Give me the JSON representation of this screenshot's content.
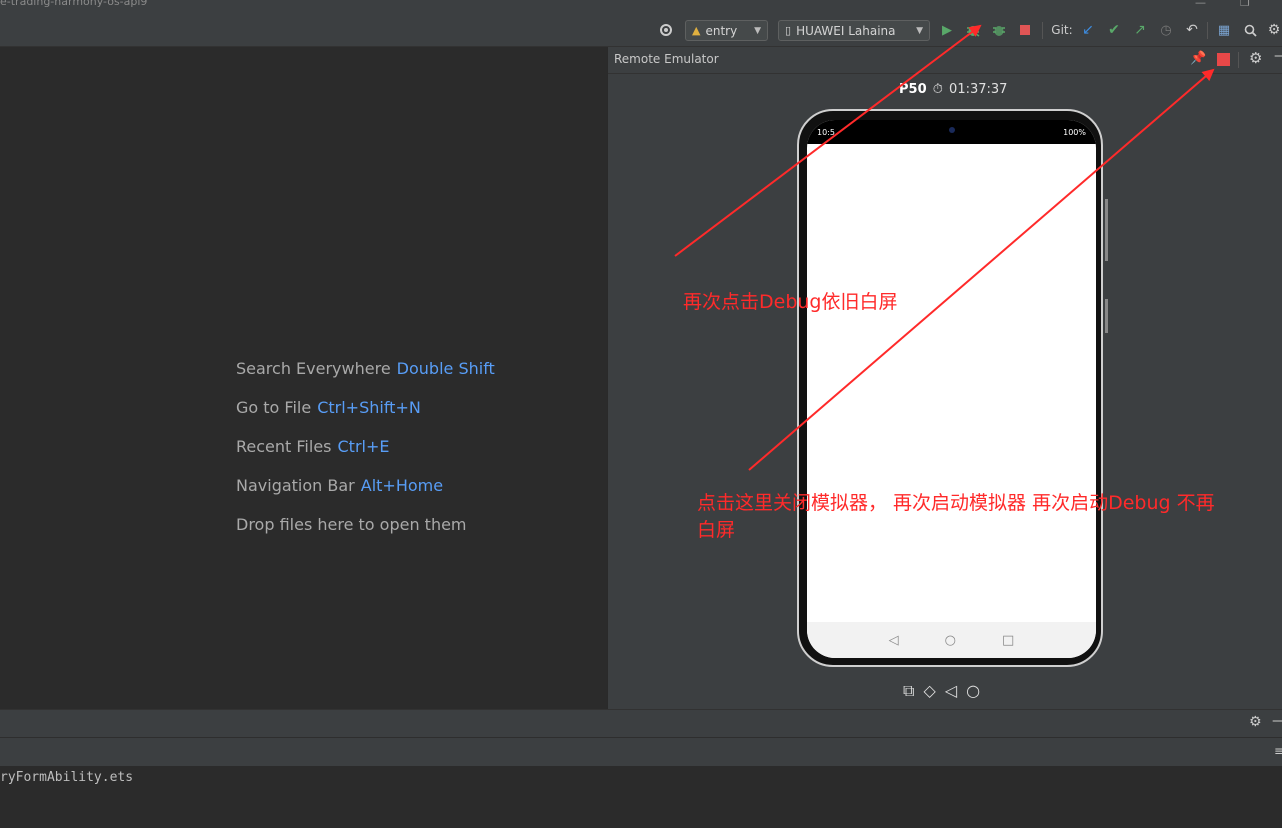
{
  "window": {
    "project_title": "e-trading-harmony-os-api9"
  },
  "toolbar": {
    "module_combo": "entry",
    "device_combo": "HUAWEI Lahaina",
    "git_label": "Git:"
  },
  "editor": {
    "hints": [
      {
        "label": "Search Everywhere",
        "key": "Double Shift"
      },
      {
        "label": "Go to File",
        "key": "Ctrl+Shift+N"
      },
      {
        "label": "Recent Files",
        "key": "Ctrl+E"
      },
      {
        "label": "Navigation Bar",
        "key": "Alt+Home"
      },
      {
        "label": "Drop files here to open them",
        "key": ""
      }
    ]
  },
  "emulator": {
    "title": "Remote Emulator",
    "device_name": "P50",
    "timer": "01:37:37",
    "status_time": "10:5",
    "status_right": "100%"
  },
  "console": {
    "line": "ryFormAbility.ets"
  },
  "annotations": {
    "note1": "再次点击Debug依旧白屏",
    "note2_line1": "点击这里关闭模拟器， 再次启动模拟器 再次启动Debug 不再",
    "note2_line2": "白屏"
  },
  "colors": {
    "annotation": "#ff2a2a",
    "run_green": "#59a869",
    "stop_red": "#e05555",
    "link_blue": "#589df6"
  }
}
